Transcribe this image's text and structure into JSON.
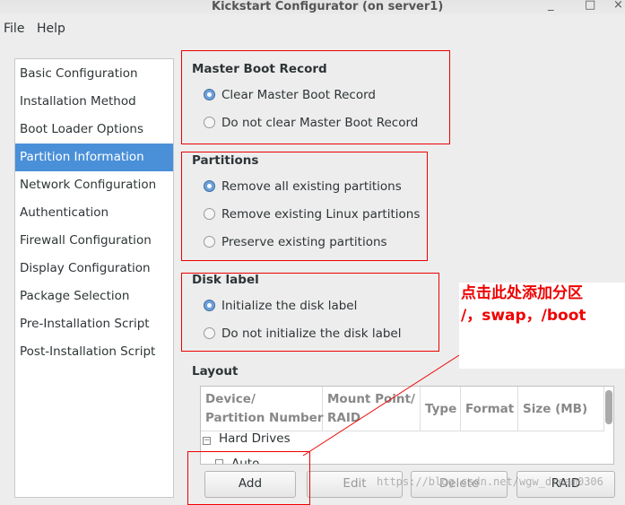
{
  "window": {
    "title": "Kickstart Configurator (on server1)",
    "minimize": "_",
    "maximize": "□",
    "close": "×"
  },
  "menu": [
    "File",
    "Help"
  ],
  "sidebar": {
    "items": [
      "Basic Configuration",
      "Installation Method",
      "Boot Loader Options",
      "Partition Information",
      "Network Configuration",
      "Authentication",
      "Firewall Configuration",
      "Display Configuration",
      "Package Selection",
      "Pre-Installation Script",
      "Post-Installation Script"
    ],
    "selected": "Partition Information"
  },
  "mbr": {
    "title": "Master Boot Record",
    "options": [
      "Clear Master Boot Record",
      "Do not clear Master Boot Record"
    ],
    "selected": 0
  },
  "partitions": {
    "title": "Partitions",
    "options": [
      "Remove all existing partitions",
      "Remove existing Linux partitions",
      "Preserve existing partitions"
    ],
    "selected": 0
  },
  "disklabel": {
    "title": "Disk label",
    "options": [
      "Initialize the disk label",
      "Do not initialize the disk label"
    ],
    "selected": 0
  },
  "layout": {
    "title": "Layout",
    "columns": [
      "Device/\nPartition Number",
      "Mount Point/\nRAID",
      "Type",
      "Format",
      "Size (MB)"
    ],
    "tree": [
      "Hard Drives",
      "Auto"
    ],
    "buttons": [
      "Add",
      "Edit",
      "Delete",
      "RAID"
    ]
  },
  "annotation": {
    "line1": "点击此处添加分区",
    "line2": "/，swap，/boot"
  },
  "watermark": "https://blog.csdn.net/wgw_dream0306",
  "colors": {
    "selection": "#4a90d9",
    "annotation": "#ee0000"
  }
}
